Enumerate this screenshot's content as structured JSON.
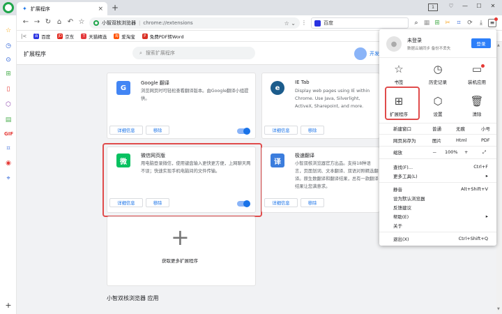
{
  "tab": {
    "title": "扩展程序",
    "close": "×",
    "new_tab": "+"
  },
  "window": {
    "counter": "1"
  },
  "omnibox": {
    "site": "小智双核浏览器",
    "sep": "|",
    "url": "chrome://extensions"
  },
  "search": {
    "engine": "百度"
  },
  "bookmarks": [
    {
      "label": "百度",
      "color": "#2932e1",
      "glyph": "百"
    },
    {
      "label": "京东",
      "color": "#e1251b",
      "glyph": "JD"
    },
    {
      "label": "天猫精选",
      "color": "#e4393c",
      "glyph": "T"
    },
    {
      "label": "爱淘宝",
      "color": "#ff5000",
      "glyph": "淘"
    },
    {
      "label": "免费PDF转Word",
      "color": "#d93025",
      "glyph": "P"
    }
  ],
  "page": {
    "title": "扩展程序",
    "search_placeholder": "搜索扩展程序",
    "dev_label": "开发者模式"
  },
  "cards": [
    {
      "name": "Google 翻译",
      "desc": "浏览网页时可轻松查看翻译版本。由Google翻译小组提供。",
      "icon_color": "#4285f4",
      "glyph": "G",
      "details": "详细信息",
      "remove": "移除"
    },
    {
      "name": "IE Tab",
      "desc": "Display web pages using IE within Chrome. Use Java, Silverlight, ActiveX, Sharepoint, and more.",
      "icon_color": "#1c5c8c",
      "glyph": "e",
      "details": "详细信息",
      "remove": "移除"
    },
    {
      "name": "微信网页版",
      "desc": "用电脑登录微信，使用键盘输入更快更方便，上网聊天两不误；快速实现手机电脑间的文件传输。",
      "icon_color": "#07c160",
      "glyph": "微",
      "details": "详细信息",
      "remove": "移除"
    },
    {
      "name": "极速翻译",
      "desc": "小智双核浏览器官方出品。支持18种语言，页面划词、文本翻译、双语对照精选翻译。原生数翻译和翻译结果，总有一款翻译结果让您满意求。",
      "icon_color": "#3b7ddd",
      "glyph": "译",
      "details": "详细信息",
      "remove": "移除"
    }
  ],
  "get_more": {
    "label": "获取更多扩展程序",
    "plus": "+"
  },
  "apps_heading": "小智双核浏览器 应用",
  "menu": {
    "user": "未登录",
    "sync_hint": "数据云端同步 备份不丢失",
    "login": "登录",
    "grid": [
      {
        "label": "书签",
        "icon": "☆"
      },
      {
        "label": "历史记录",
        "icon": "◷"
      },
      {
        "label": "装机应用",
        "icon": "▭"
      },
      {
        "label": "扩展程序",
        "icon": "⊞"
      },
      {
        "label": "设置",
        "icon": "⬡"
      },
      {
        "label": "清除",
        "icon": "🗑"
      }
    ],
    "new_window": "新建窗口",
    "normal": "普通",
    "incognito": "无痕",
    "small": "小号",
    "save_as": "网页另存为",
    "image": "图片",
    "html": "Html",
    "pdf": "PDF",
    "zoom_label": "缩放",
    "zoom_minus": "－",
    "zoom_value": "100%",
    "zoom_plus": "+",
    "fullscreen": "⤢",
    "items": [
      {
        "label": "查找(F)...",
        "shortcut": "Ctrl+F"
      },
      {
        "label": "更多工具(L)",
        "shortcut": "▸"
      },
      {
        "label": "静音",
        "shortcut": "Alt+Shift+V"
      },
      {
        "label": "设为默认浏览器",
        "shortcut": ""
      },
      {
        "label": "反馈建议",
        "shortcut": ""
      },
      {
        "label": "帮助(E)",
        "shortcut": "▸"
      },
      {
        "label": "关于",
        "shortcut": ""
      },
      {
        "label": "退出(X)",
        "shortcut": "Ctrl+Shift+Q"
      }
    ]
  }
}
